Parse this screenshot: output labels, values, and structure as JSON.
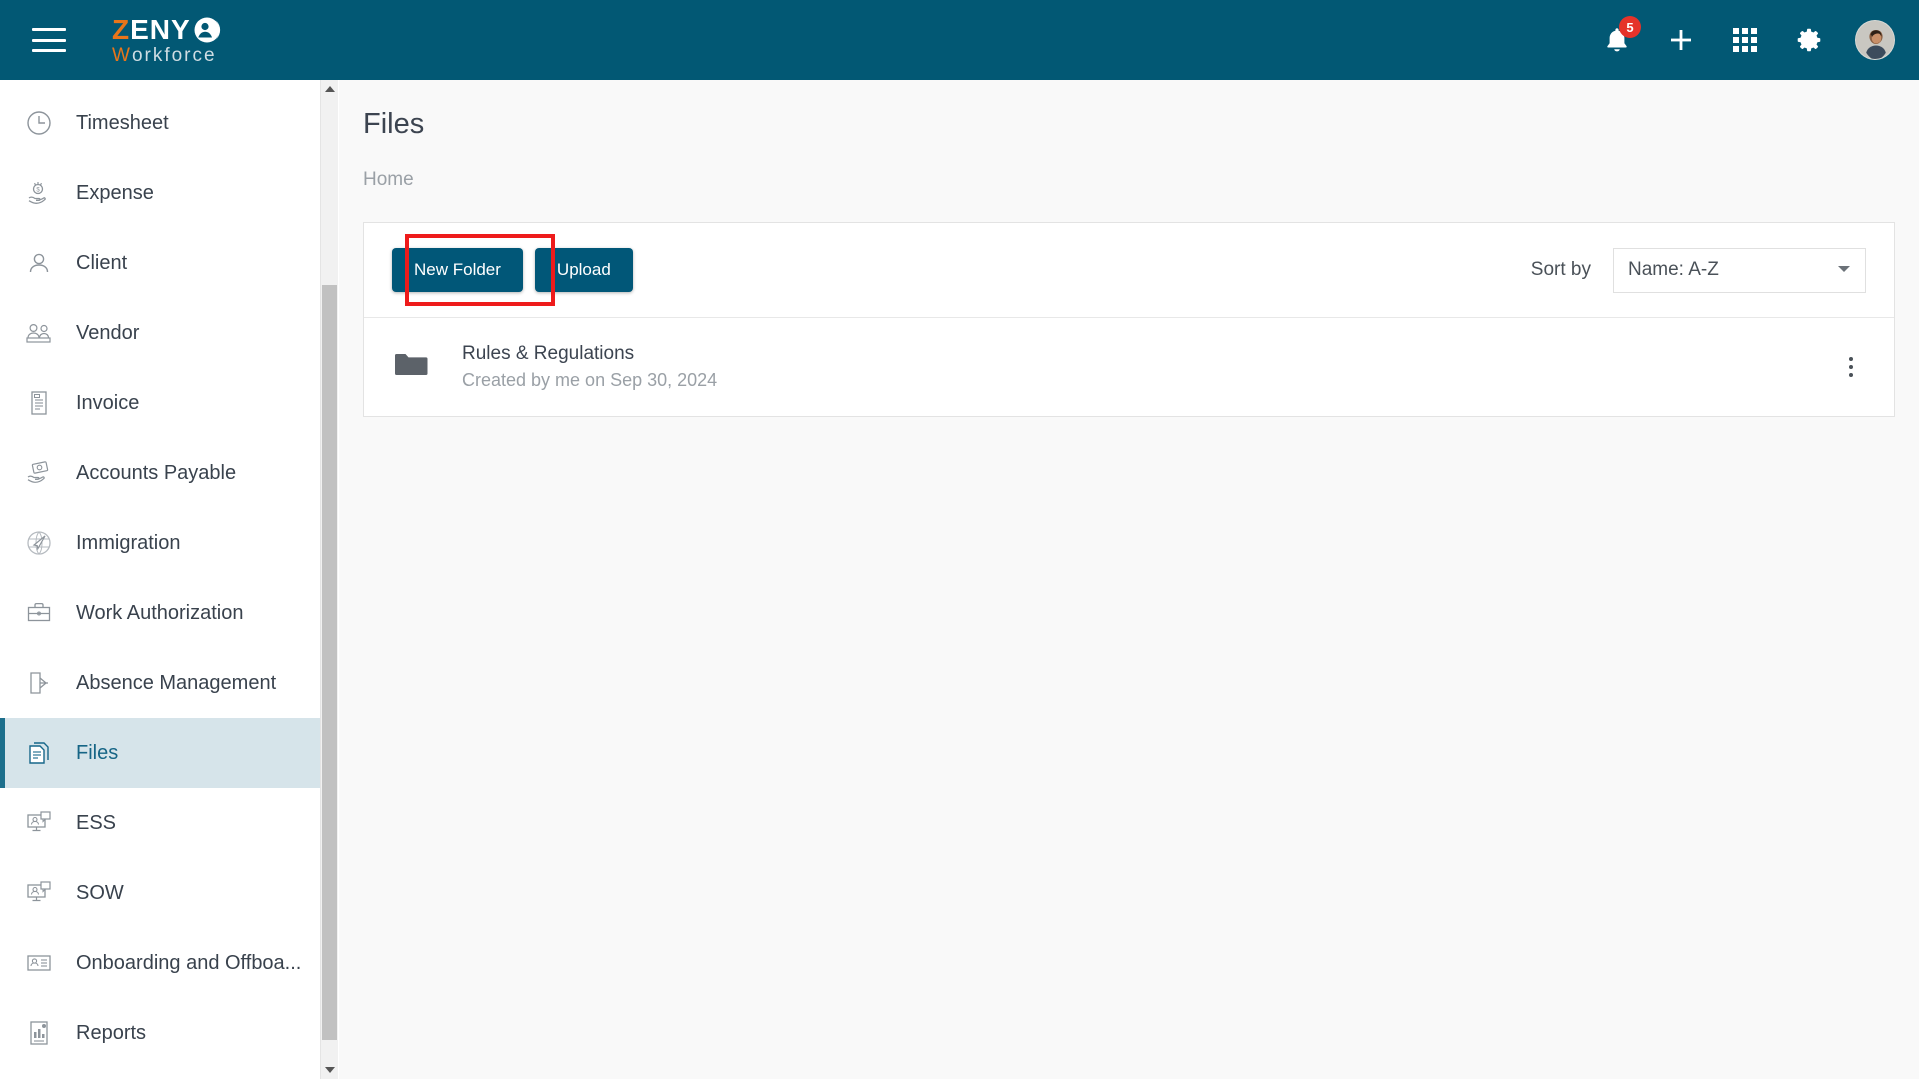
{
  "header": {
    "menu_icon": "hamburger-icon",
    "logo": {
      "part1": "Z",
      "part2": "ENY",
      "part3": "W",
      "part4": "orkforce",
      "mark": "person-circle-icon"
    },
    "notifications": {
      "icon": "bell-icon",
      "count": "5"
    },
    "add": {
      "icon": "plus-icon"
    },
    "apps": {
      "icon": "grid-apps-icon"
    },
    "settings": {
      "icon": "gear-icon"
    },
    "profile": {
      "icon": "avatar"
    }
  },
  "sidebar": {
    "items": [
      {
        "label": "",
        "icon": "partial-cut-icon",
        "active": false
      },
      {
        "label": "Timesheet",
        "icon": "clock-icon",
        "active": false
      },
      {
        "label": "Expense",
        "icon": "hand-money-icon",
        "active": false
      },
      {
        "label": "Client",
        "icon": "person-icon",
        "active": false
      },
      {
        "label": "Vendor",
        "icon": "people-icon",
        "active": false
      },
      {
        "label": "Invoice",
        "icon": "receipt-icon",
        "active": false
      },
      {
        "label": "Accounts Payable",
        "icon": "hand-card-icon",
        "active": false
      },
      {
        "label": "Immigration",
        "icon": "globe-plane-icon",
        "active": false
      },
      {
        "label": "Work Authorization",
        "icon": "briefcase-icon",
        "active": false
      },
      {
        "label": "Absence Management",
        "icon": "door-exit-icon",
        "active": false
      },
      {
        "label": "Files",
        "icon": "documents-icon",
        "active": true
      },
      {
        "label": "ESS",
        "icon": "monitor-person-icon",
        "active": false
      },
      {
        "label": "SOW",
        "icon": "monitor-person-icon",
        "active": false
      },
      {
        "label": "Onboarding and Offboa...",
        "icon": "id-card-icon",
        "active": false
      },
      {
        "label": "Reports",
        "icon": "report-chart-icon",
        "active": false
      }
    ],
    "scrollbar": {
      "up_icon": "scroll-up-arrow-icon",
      "down_icon": "scroll-down-arrow-icon"
    }
  },
  "main": {
    "title": "Files",
    "breadcrumb": "Home",
    "toolbar": {
      "new_folder_label": "New Folder",
      "upload_label": "Upload",
      "sort_label": "Sort by",
      "sort_value": "Name: A-Z",
      "sort_caret_icon": "chevron-down-icon"
    },
    "files": [
      {
        "name": "Rules & Regulations",
        "subtitle": "Created by me on Sep 30, 2024",
        "icon": "folder-icon",
        "menu_icon": "kebab-menu-icon"
      }
    ]
  },
  "colors": {
    "header_bg": "#025874",
    "accent_orange": "#e8751a",
    "primary_button": "#015778",
    "active_nav_bg": "#d6e4ea",
    "active_nav_text": "#166586",
    "badge_red": "#e5332a",
    "highlight_box": "#ee1b1b",
    "content_bg": "#f9f9f9"
  }
}
